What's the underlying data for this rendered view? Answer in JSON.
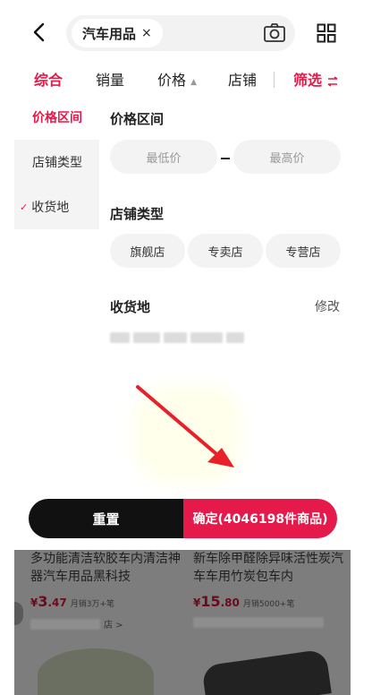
{
  "search": {
    "tag": "汽车用品",
    "close": "×"
  },
  "tabs": [
    {
      "label": "综合"
    },
    {
      "label": "销量"
    },
    {
      "label": "价格"
    },
    {
      "label": "店铺"
    },
    {
      "label": "筛选"
    }
  ],
  "sidebar": {
    "items": [
      {
        "label": "价格区间"
      },
      {
        "label": "店铺类型"
      },
      {
        "label": "收货地",
        "check": "✓"
      }
    ]
  },
  "price_section": {
    "title": "价格区间",
    "min_placeholder": "最低价",
    "max_placeholder": "最高价"
  },
  "shop_type_section": {
    "title": "店铺类型",
    "options": [
      "旗舰店",
      "专卖店",
      "专营店"
    ]
  },
  "ship_section": {
    "title": "收货地",
    "modify": "修改"
  },
  "buttons": {
    "reset": "重置",
    "confirm": "确定(4046198件商品)"
  },
  "products": [
    {
      "title": "多功能清洁软胶车内清洁神器汽车用品黑科技",
      "currency": "¥",
      "price_int": "3",
      "price_dec": ".47",
      "sales": "月销3万+笔",
      "shop_suffix": "店 >"
    },
    {
      "title": "新车除甲醛除异味活性炭汽车车用竹炭包车内",
      "currency": "¥",
      "price_int": "15",
      "price_dec": ".80",
      "sales": "月销5000+笔",
      "shop_suffix": ""
    }
  ],
  "colors": {
    "accent": "#e5194a",
    "dark_button": "#111111"
  }
}
